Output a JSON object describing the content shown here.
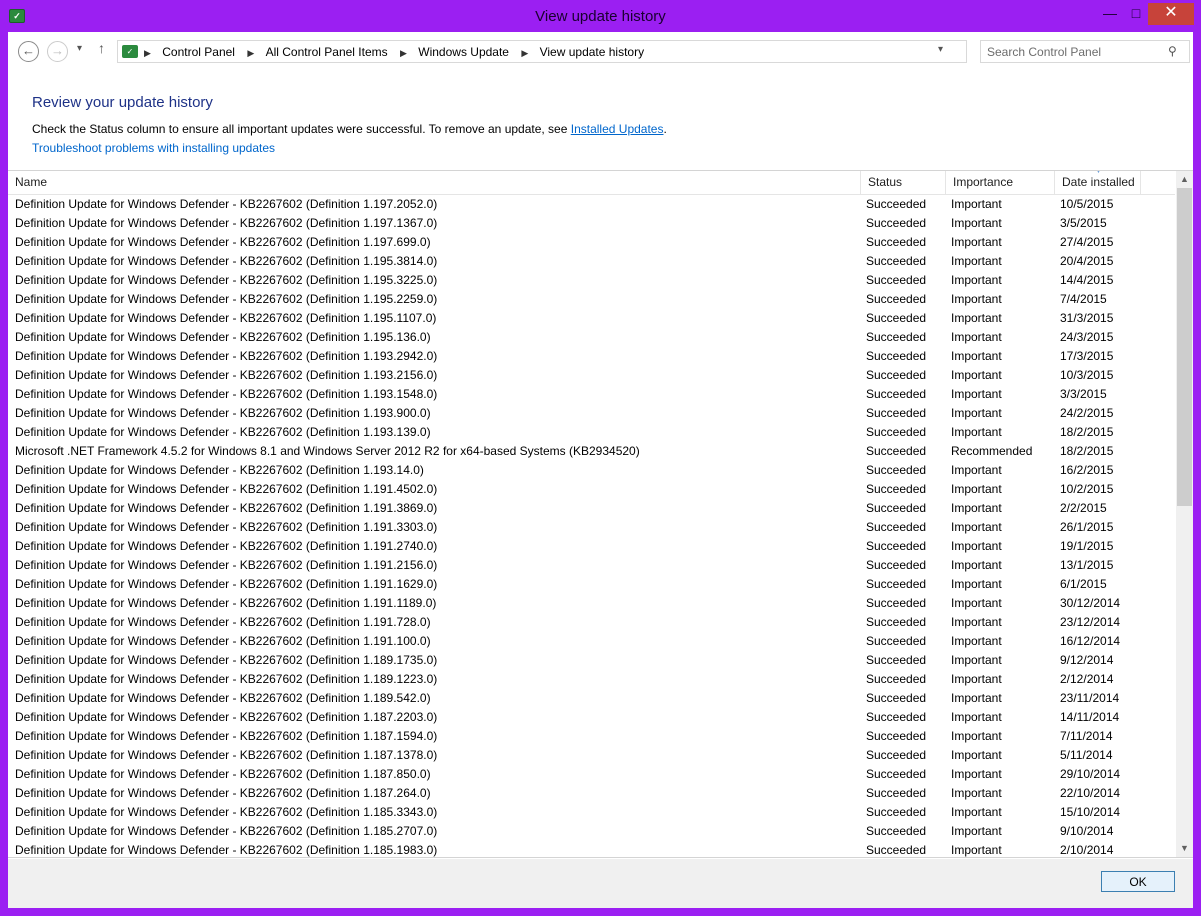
{
  "window": {
    "title": "View update history",
    "min_label": "—",
    "max_label": "□",
    "close_label": "✕",
    "icon": "control-panel-icon"
  },
  "nav": {
    "back_icon": "←",
    "forward_icon": "→",
    "recent_icon": "▾",
    "up_icon": "↑",
    "breadcrumbs": [
      "Control Panel",
      "All Control Panel Items",
      "Windows Update",
      "View update history"
    ],
    "refresh_icon": "⟳",
    "search_placeholder": "Search Control Panel"
  },
  "header": {
    "heading": "Review your update history",
    "description_prefix": "Check the Status column to ensure all important updates were successful. To remove an update, see ",
    "installed_updates_link": "Installed Updates",
    "description_suffix": ".",
    "troubleshoot_link": "Troubleshoot problems with installing updates"
  },
  "table": {
    "columns": [
      "Name",
      "Status",
      "Importance",
      "Date installed"
    ],
    "rows": [
      [
        "Definition Update for Windows Defender - KB2267602 (Definition 1.197.2052.0)",
        "Succeeded",
        "Important",
        "10/5/2015"
      ],
      [
        "Definition Update for Windows Defender - KB2267602 (Definition 1.197.1367.0)",
        "Succeeded",
        "Important",
        "3/5/2015"
      ],
      [
        "Definition Update for Windows Defender - KB2267602 (Definition 1.197.699.0)",
        "Succeeded",
        "Important",
        "27/4/2015"
      ],
      [
        "Definition Update for Windows Defender - KB2267602 (Definition 1.195.3814.0)",
        "Succeeded",
        "Important",
        "20/4/2015"
      ],
      [
        "Definition Update for Windows Defender - KB2267602 (Definition 1.195.3225.0)",
        "Succeeded",
        "Important",
        "14/4/2015"
      ],
      [
        "Definition Update for Windows Defender - KB2267602 (Definition 1.195.2259.0)",
        "Succeeded",
        "Important",
        "7/4/2015"
      ],
      [
        "Definition Update for Windows Defender - KB2267602 (Definition 1.195.1107.0)",
        "Succeeded",
        "Important",
        "31/3/2015"
      ],
      [
        "Definition Update for Windows Defender - KB2267602 (Definition 1.195.136.0)",
        "Succeeded",
        "Important",
        "24/3/2015"
      ],
      [
        "Definition Update for Windows Defender - KB2267602 (Definition 1.193.2942.0)",
        "Succeeded",
        "Important",
        "17/3/2015"
      ],
      [
        "Definition Update for Windows Defender - KB2267602 (Definition 1.193.2156.0)",
        "Succeeded",
        "Important",
        "10/3/2015"
      ],
      [
        "Definition Update for Windows Defender - KB2267602 (Definition 1.193.1548.0)",
        "Succeeded",
        "Important",
        "3/3/2015"
      ],
      [
        "Definition Update for Windows Defender - KB2267602 (Definition 1.193.900.0)",
        "Succeeded",
        "Important",
        "24/2/2015"
      ],
      [
        "Definition Update for Windows Defender - KB2267602 (Definition 1.193.139.0)",
        "Succeeded",
        "Important",
        "18/2/2015"
      ],
      [
        "Microsoft .NET Framework 4.5.2 for Windows 8.1 and Windows Server 2012 R2 for x64-based Systems (KB2934520)",
        "Succeeded",
        "Recommended",
        "18/2/2015"
      ],
      [
        "Definition Update for Windows Defender - KB2267602 (Definition 1.193.14.0)",
        "Succeeded",
        "Important",
        "16/2/2015"
      ],
      [
        "Definition Update for Windows Defender - KB2267602 (Definition 1.191.4502.0)",
        "Succeeded",
        "Important",
        "10/2/2015"
      ],
      [
        "Definition Update for Windows Defender - KB2267602 (Definition 1.191.3869.0)",
        "Succeeded",
        "Important",
        "2/2/2015"
      ],
      [
        "Definition Update for Windows Defender - KB2267602 (Definition 1.191.3303.0)",
        "Succeeded",
        "Important",
        "26/1/2015"
      ],
      [
        "Definition Update for Windows Defender - KB2267602 (Definition 1.191.2740.0)",
        "Succeeded",
        "Important",
        "19/1/2015"
      ],
      [
        "Definition Update for Windows Defender - KB2267602 (Definition 1.191.2156.0)",
        "Succeeded",
        "Important",
        "13/1/2015"
      ],
      [
        "Definition Update for Windows Defender - KB2267602 (Definition 1.191.1629.0)",
        "Succeeded",
        "Important",
        "6/1/2015"
      ],
      [
        "Definition Update for Windows Defender - KB2267602 (Definition 1.191.1189.0)",
        "Succeeded",
        "Important",
        "30/12/2014"
      ],
      [
        "Definition Update for Windows Defender - KB2267602 (Definition 1.191.728.0)",
        "Succeeded",
        "Important",
        "23/12/2014"
      ],
      [
        "Definition Update for Windows Defender - KB2267602 (Definition 1.191.100.0)",
        "Succeeded",
        "Important",
        "16/12/2014"
      ],
      [
        "Definition Update for Windows Defender - KB2267602 (Definition 1.189.1735.0)",
        "Succeeded",
        "Important",
        "9/12/2014"
      ],
      [
        "Definition Update for Windows Defender - KB2267602 (Definition 1.189.1223.0)",
        "Succeeded",
        "Important",
        "2/12/2014"
      ],
      [
        "Definition Update for Windows Defender - KB2267602 (Definition 1.189.542.0)",
        "Succeeded",
        "Important",
        "23/11/2014"
      ],
      [
        "Definition Update for Windows Defender - KB2267602 (Definition 1.187.2203.0)",
        "Succeeded",
        "Important",
        "14/11/2014"
      ],
      [
        "Definition Update for Windows Defender - KB2267602 (Definition 1.187.1594.0)",
        "Succeeded",
        "Important",
        "7/11/2014"
      ],
      [
        "Definition Update for Windows Defender - KB2267602 (Definition 1.187.1378.0)",
        "Succeeded",
        "Important",
        "5/11/2014"
      ],
      [
        "Definition Update for Windows Defender - KB2267602 (Definition 1.187.850.0)",
        "Succeeded",
        "Important",
        "29/10/2014"
      ],
      [
        "Definition Update for Windows Defender - KB2267602 (Definition 1.187.264.0)",
        "Succeeded",
        "Important",
        "22/10/2014"
      ],
      [
        "Definition Update for Windows Defender - KB2267602 (Definition 1.185.3343.0)",
        "Succeeded",
        "Important",
        "15/10/2014"
      ],
      [
        "Definition Update for Windows Defender - KB2267602 (Definition 1.185.2707.0)",
        "Succeeded",
        "Important",
        "9/10/2014"
      ],
      [
        "Definition Update for Windows Defender - KB2267602 (Definition 1.185.1983.0)",
        "Succeeded",
        "Important",
        "2/10/2014"
      ]
    ]
  },
  "footer": {
    "ok_label": "OK"
  },
  "colors": {
    "frame": "#9b1ff2",
    "close": "#c7433a",
    "heading": "#1e3287",
    "link": "#0066cc"
  }
}
